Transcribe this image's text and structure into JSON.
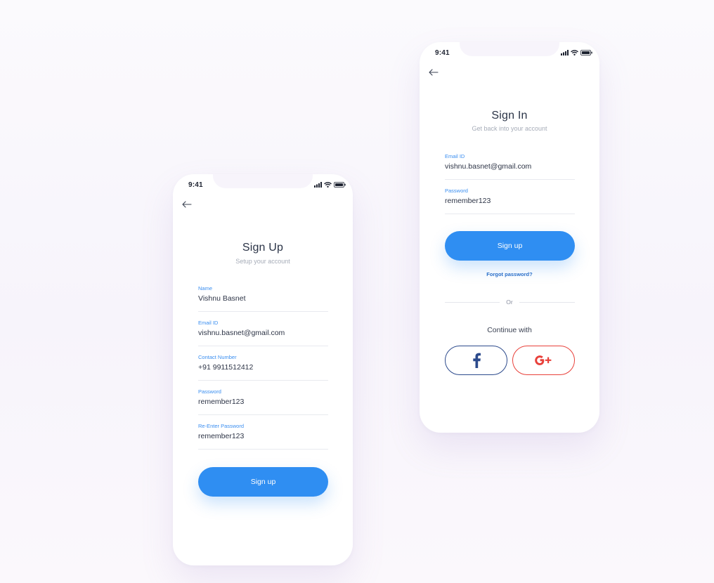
{
  "colors": {
    "primary": "#2f8ef2",
    "label": "#3a8ef0",
    "facebook": "#2c4a8c",
    "google": "#e8403a"
  },
  "signup_screen": {
    "status_time": "9:41",
    "title": "Sign Up",
    "subtitle": "Setup your account",
    "fields": [
      {
        "label": "Name",
        "value": "Vishnu Basnet"
      },
      {
        "label": "Email ID",
        "value": "vishnu.basnet@gmail.com"
      },
      {
        "label": "Contact Number",
        "value": "+91 9911512412"
      },
      {
        "label": "Password",
        "value": "remember123"
      },
      {
        "label": "Re-Enter Password",
        "value": "remember123"
      }
    ],
    "button_label": "Sign up"
  },
  "signin_screen": {
    "status_time": "9:41",
    "title": "Sign In",
    "subtitle": "Get back into your account",
    "fields": [
      {
        "label": "Email ID",
        "value": "vishnu.basnet@gmail.com"
      },
      {
        "label": "Password",
        "value": "remember123"
      }
    ],
    "button_label": "Sign up",
    "forgot_password": "Forgot password?",
    "divider_text": "Or",
    "continue_with": "Continue with",
    "social": {
      "facebook_glyph": "f",
      "google_glyph": "g+"
    }
  },
  "icons": [
    "back-arrow-icon",
    "signal-icon",
    "wifi-icon",
    "battery-icon",
    "facebook-icon",
    "google-plus-icon"
  ]
}
